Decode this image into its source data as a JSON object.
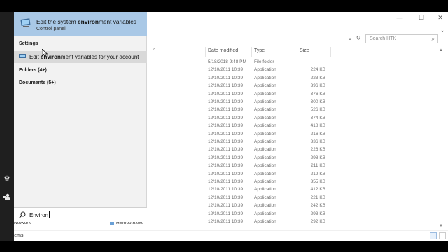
{
  "explorer": {
    "search_placeholder": "Search HTK",
    "columns": {
      "name": "",
      "date": "Date modified",
      "type": "Type",
      "size": "Size"
    },
    "rows": [
      {
        "date": "5/18/2018 9:48 PM",
        "type": "File folder",
        "size": ""
      },
      {
        "date": "12/10/2011 10:39",
        "type": "Application",
        "size": "224 KB"
      },
      {
        "date": "12/10/2011 10:39",
        "type": "Application",
        "size": "223 KB"
      },
      {
        "date": "12/10/2011 10:39",
        "type": "Application",
        "size": "396 KB"
      },
      {
        "date": "12/10/2011 10:39",
        "type": "Application",
        "size": "376 KB"
      },
      {
        "date": "12/10/2011 10:39",
        "type": "Application",
        "size": "300 KB"
      },
      {
        "date": "12/10/2011 10:39",
        "type": "Application",
        "size": "526 KB"
      },
      {
        "date": "12/10/2011 10:39",
        "type": "Application",
        "size": "374 KB"
      },
      {
        "date": "12/10/2011 10:39",
        "type": "Application",
        "size": "418 KB"
      },
      {
        "date": "12/10/2011 10:39",
        "type": "Application",
        "size": "216 KB"
      },
      {
        "date": "12/10/2011 10:39",
        "type": "Application",
        "size": "336 KB"
      },
      {
        "date": "12/10/2011 10:39",
        "type": "Application",
        "size": "226 KB"
      },
      {
        "date": "12/10/2011 10:39",
        "type": "Application",
        "size": "298 KB"
      },
      {
        "date": "12/10/2011 10:39",
        "type": "Application",
        "size": "211 KB"
      },
      {
        "date": "12/10/2011 10:39",
        "type": "Application",
        "size": "219 KB"
      },
      {
        "date": "12/10/2011 10:39",
        "type": "Application",
        "size": "355 KB"
      },
      {
        "date": "12/10/2011 10:39",
        "type": "Application",
        "size": "412 KB"
      },
      {
        "date": "12/10/2011 10:39",
        "type": "Application",
        "size": "221 KB"
      },
      {
        "date": "12/10/2011 10:39",
        "type": "Application",
        "size": "242 KB"
      },
      {
        "date": "12/10/2011 10:39",
        "type": "Application",
        "size": "293 KB"
      },
      {
        "date": "12/10/2011 10:39",
        "type": "Application",
        "size": "292 KB"
      }
    ],
    "nav_item": "Network",
    "file_item": "HSmooth.exe",
    "status": "34 items"
  },
  "search_panel": {
    "best_match_title_pre": "Edit the system ",
    "best_match_title_bold": "environ",
    "best_match_title_post": "ment variables",
    "best_match_sub": "Control panel",
    "settings_heading": "Settings",
    "settings_item_pre": "Edit ",
    "settings_item_bold": "environ",
    "settings_item_post": "ment variables for your account",
    "folders_heading": "Folders (4+)",
    "documents_heading": "Documents (5+)",
    "query": "Environ"
  },
  "taskbar": {
    "gear_icon": "gear-icon",
    "user_icon": "user-icon"
  }
}
